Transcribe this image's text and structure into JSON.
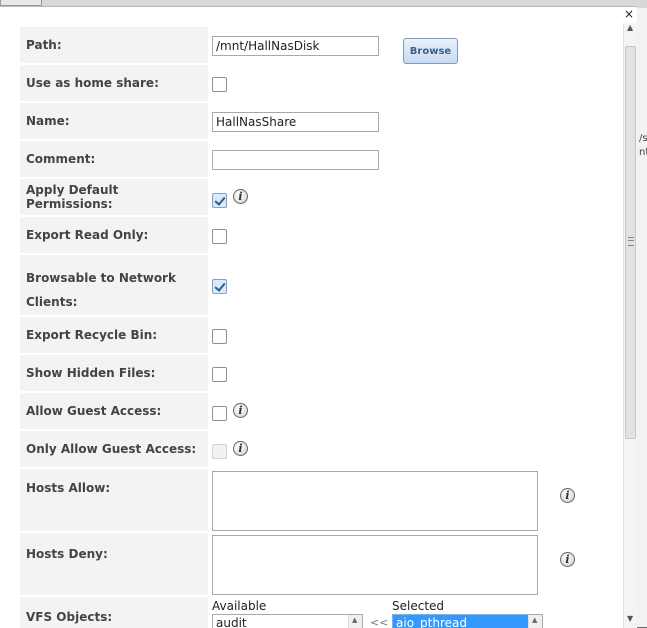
{
  "dialog": {
    "close_label": "×"
  },
  "background": {
    "peek_text": [
      "/s",
      "nt"
    ]
  },
  "form": {
    "path": {
      "label": "Path:",
      "value": "/mnt/HallNasDisk",
      "browse_label": "Browse"
    },
    "home_share": {
      "label": "Use as home share:",
      "checked": false
    },
    "name": {
      "label": "Name:",
      "value": "HallNasShare"
    },
    "comment": {
      "label": "Comment:",
      "value": ""
    },
    "default_permissions": {
      "label": "Apply Default Permissions:",
      "checked": true,
      "info": "i"
    },
    "read_only": {
      "label": "Export Read Only:",
      "checked": false
    },
    "browsable": {
      "label_line1": "Browsable to Network",
      "label_line2": "Clients:",
      "checked": true
    },
    "recycle_bin": {
      "label": "Export Recycle Bin:",
      "checked": false
    },
    "hidden_files": {
      "label": "Show Hidden Files:",
      "checked": false
    },
    "guest_access": {
      "label": "Allow Guest Access:",
      "checked": false,
      "info": "i"
    },
    "only_guest": {
      "label": "Only Allow Guest Access:",
      "checked": false,
      "disabled": true,
      "info": "i"
    },
    "hosts_allow": {
      "label": "Hosts Allow:",
      "value": "",
      "info": "i"
    },
    "hosts_deny": {
      "label": "Hosts Deny:",
      "value": "",
      "info": "i"
    },
    "vfs": {
      "label": "VFS Objects:",
      "available_caption": "Available",
      "selected_caption": "Selected",
      "available_items": [
        "audit"
      ],
      "selected_items": [
        "aio_pthread"
      ],
      "move_left_label": "<<"
    }
  }
}
